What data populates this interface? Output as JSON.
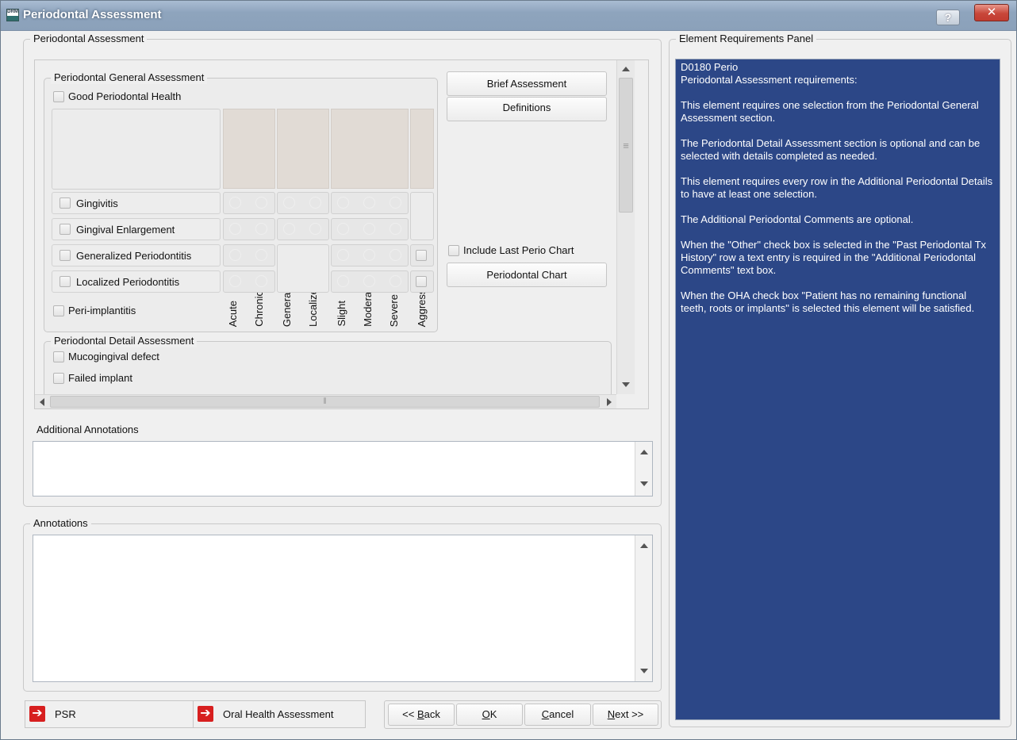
{
  "window": {
    "title": "Periodontal Assessment",
    "icon_text": "DRM",
    "help_label": "?",
    "close_label": "✕"
  },
  "main_group": {
    "legend": "Periodontal Assessment"
  },
  "general": {
    "legend": "Periodontal General Assessment",
    "good_health_label": "Good Periodontal Health",
    "columns": [
      "Acute",
      "Chronic",
      "Generalized",
      "Localized",
      "Slight",
      "Moderate",
      "Severe",
      "Aggressive"
    ],
    "rows": [
      {
        "label": "Gingivitis"
      },
      {
        "label": "Gingival Enlargement"
      },
      {
        "label": "Generalized Periodontitis"
      },
      {
        "label": "Localized Periodontitis"
      }
    ],
    "peri_implantitis_label": "Peri-implantitis"
  },
  "side_buttons": {
    "brief_assessment": "Brief Assessment",
    "definitions": "Definitions",
    "include_last_chart": "Include Last Perio Chart",
    "periodontal_chart": "Periodontal Chart"
  },
  "detail": {
    "legend": "Periodontal Detail Assessment",
    "items": [
      "Mucogingival defect",
      "Failed implant"
    ]
  },
  "additional_annotations": {
    "label": "Additional Annotations",
    "value": ""
  },
  "annotations": {
    "legend": "Annotations",
    "value": ""
  },
  "footer": {
    "psr_label": "PSR",
    "oha_label": "Oral Health Assessment",
    "back_label_pre": "<< ",
    "back_label_key": "B",
    "back_label_post": "ack",
    "ok_label_key": "O",
    "ok_label_post": "K",
    "cancel_label_key": "C",
    "cancel_label_post": "ancel",
    "next_label_key": "N",
    "next_label_post": "ext >>"
  },
  "requirements": {
    "legend": "Element Requirements Panel",
    "heading1": "D0180  Perio",
    "heading2": "Periodontal Assessment requirements:",
    "paragraphs": [
      "This element requires one selection from the Periodontal General Assessment section.",
      "The Periodontal Detail Assessment section is optional and can be selected with details completed as needed.",
      "This element requires every row in the Additional Periodontal Details to have at least one selection.",
      "The Additional Periodontal Comments are optional.",
      "When the \"Other\" check box is selected in the \"Past Periodontal Tx History\" row a text entry is required in the \"Additional Periodontal Comments\" text box.",
      "When the OHA check box \"Patient has no remaining functional teeth, roots or implants\" is selected this element will be satisfied."
    ]
  },
  "scroll_marks": {
    "grip": "≡",
    "hgrip": "⦀"
  }
}
